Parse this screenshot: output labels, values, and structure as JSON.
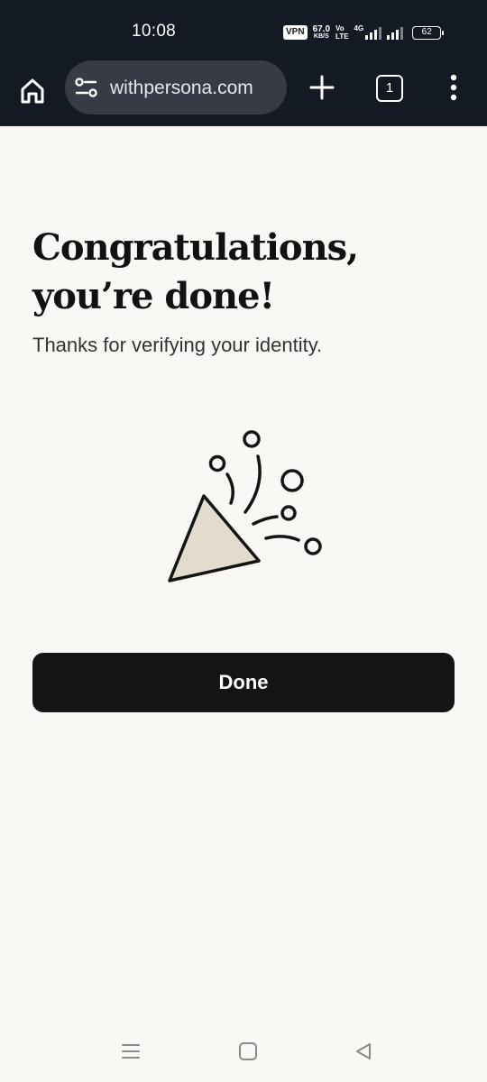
{
  "status_bar": {
    "time": "10:08",
    "vpn": "VPN",
    "net_speed_value": "67.0",
    "net_speed_unit": "KB/S",
    "volte_top": "Vo",
    "volte_bottom": "LTE",
    "network_type": "4G",
    "battery_level": "62"
  },
  "browser": {
    "url": "withpersona.com",
    "tab_count": "1"
  },
  "content": {
    "heading": "Congratulations, you’re done!",
    "subtext": "Thanks for verifying your identity.",
    "done_label": "Done"
  },
  "colors": {
    "background": "#f9f8f5",
    "button": "#141414",
    "status_bar": "#141a24",
    "party_hat_fill": "#e3dbcd"
  },
  "icons": {
    "home": "home-icon",
    "site_settings": "site-settings-icon",
    "new_tab": "plus-icon",
    "more": "more-vertical-icon",
    "illustration": "party-popper-icon",
    "nav_recents": "recents-icon",
    "nav_home": "nav-home-icon",
    "nav_back": "back-icon"
  }
}
